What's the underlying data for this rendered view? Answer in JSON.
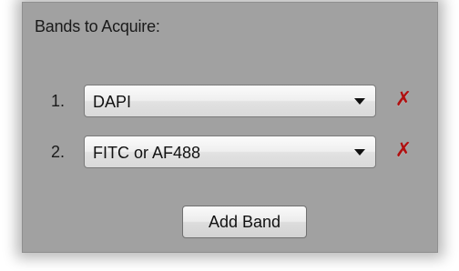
{
  "panel": {
    "title": "Bands to Acquire:"
  },
  "bands": [
    {
      "number": "1.",
      "selected": "DAPI",
      "remove_icon": "x-icon",
      "remove_glyph": "✗"
    },
    {
      "number": "2.",
      "selected": "FITC or AF488",
      "remove_icon": "x-icon",
      "remove_glyph": "✗"
    }
  ],
  "add_button_label": "Add Band",
  "colors": {
    "panel_bg": "#a1a1a1",
    "remove_red": "#b01010"
  }
}
